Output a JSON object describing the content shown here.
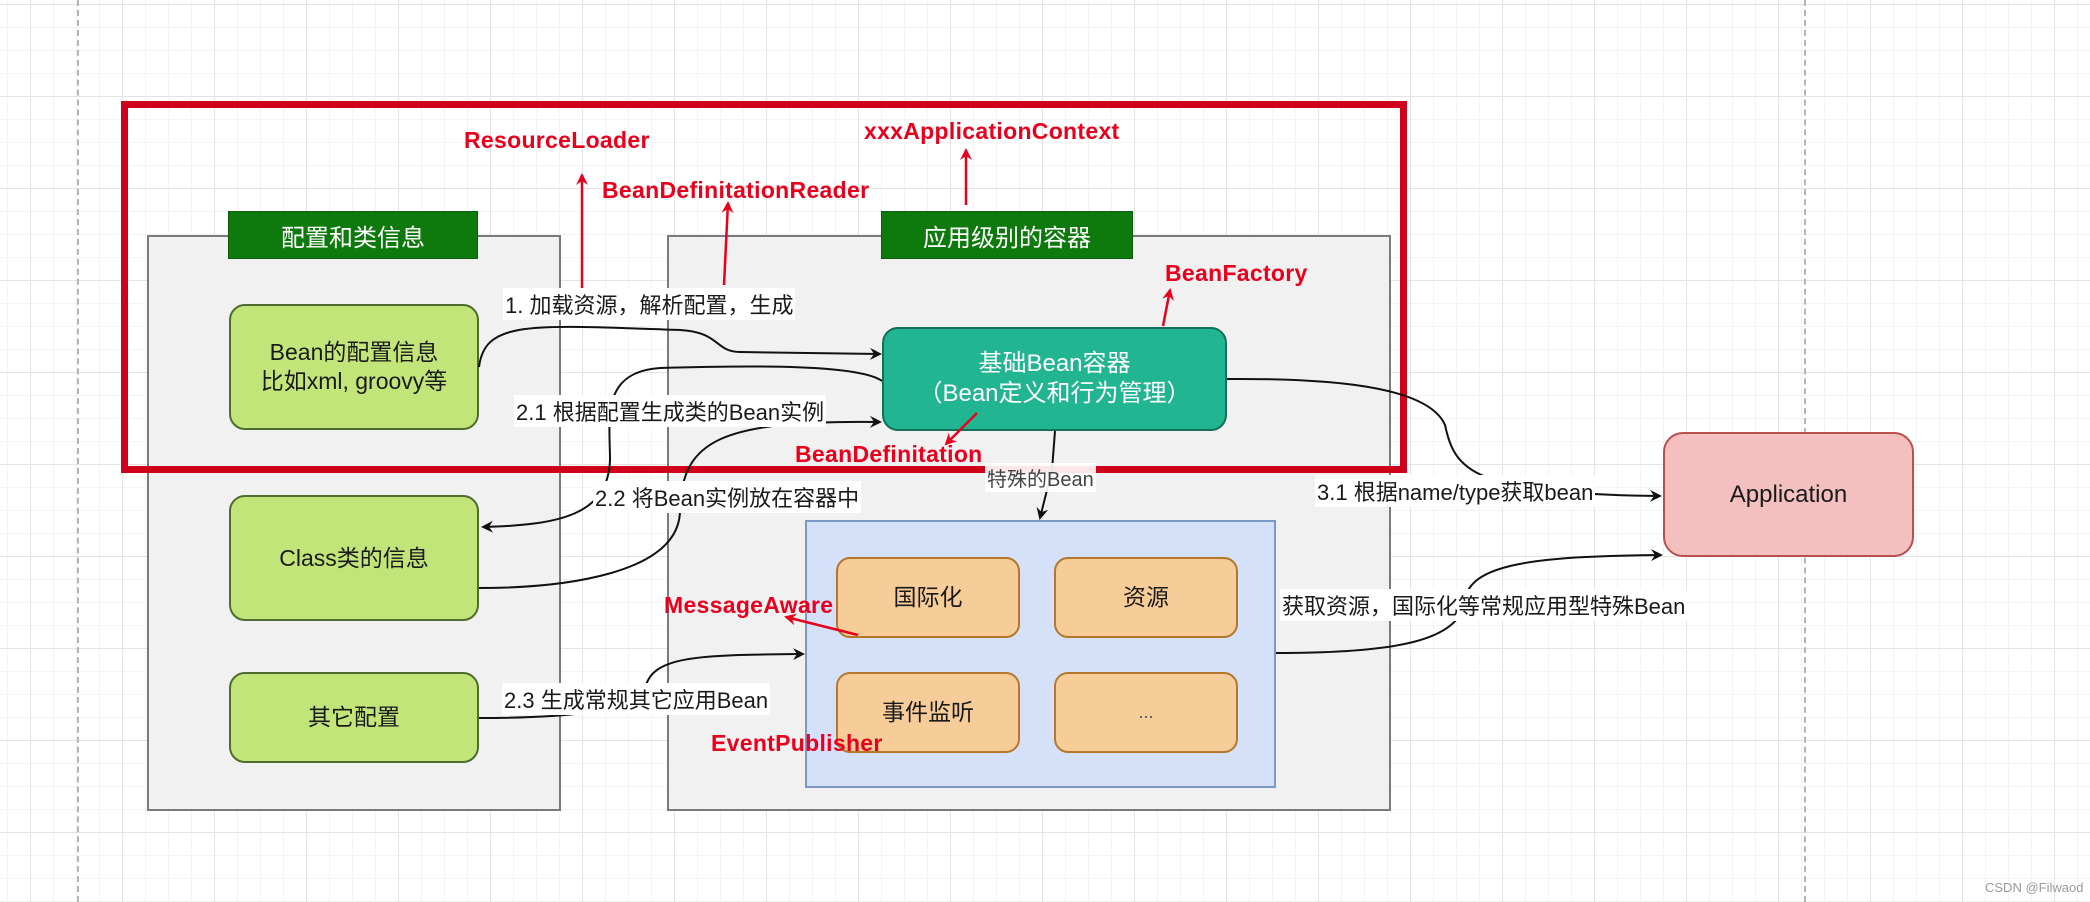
{
  "diagram": {
    "highlight_box": {
      "color": "#d0021b"
    },
    "groups": [
      {
        "id": "config",
        "header": "配置和类信息"
      },
      {
        "id": "container",
        "header": "应用级别的容器"
      }
    ],
    "nodes": {
      "bean_config": {
        "line1": "Bean的配置信息",
        "line2": "比如xml, groovy等"
      },
      "class_info": {
        "label": "Class类的信息"
      },
      "other_config": {
        "label": "其它配置"
      },
      "bean_container": {
        "line1": "基础Bean容器",
        "line2": "（Bean定义和行为管理）"
      },
      "special_beans": [
        {
          "label": "国际化"
        },
        {
          "label": "资源"
        },
        {
          "label": "事件监听"
        },
        {
          "label": "..."
        }
      ],
      "application": {
        "label": "Application"
      }
    },
    "edge_labels": {
      "load": "1. 加载资源，解析配置，生成",
      "create_instance": "2.1  根据配置生成类的Bean实例",
      "put_instance": "2.2 将Bean实例放在容器中",
      "create_other": "2.3 生成常规其它应用Bean",
      "special_bean": "特殊的Bean",
      "get_bean": "3.1 根据name/type获取bean",
      "get_resources": "获取资源，国际化等常规应用型特殊Bean"
    },
    "annotations": {
      "resource_loader": "ResourceLoader",
      "definition_reader": "BeanDefinitationReader",
      "application_context": "xxxApplicationContext",
      "bean_factory": "BeanFactory",
      "bean_definition": "BeanDefinitation",
      "message_aware": "MessageAware",
      "event_publisher": "EventPublisher"
    },
    "colors": {
      "annotation_red": "#e8001c",
      "header_green": "#0e7a0d",
      "node_green": "#c2e57a",
      "node_teal": "#22b592",
      "node_orange": "#f6cc99",
      "node_blue": "#d4e1f8",
      "node_pink": "#f3c0bf"
    }
  },
  "watermark": "CSDN @Filwaod"
}
